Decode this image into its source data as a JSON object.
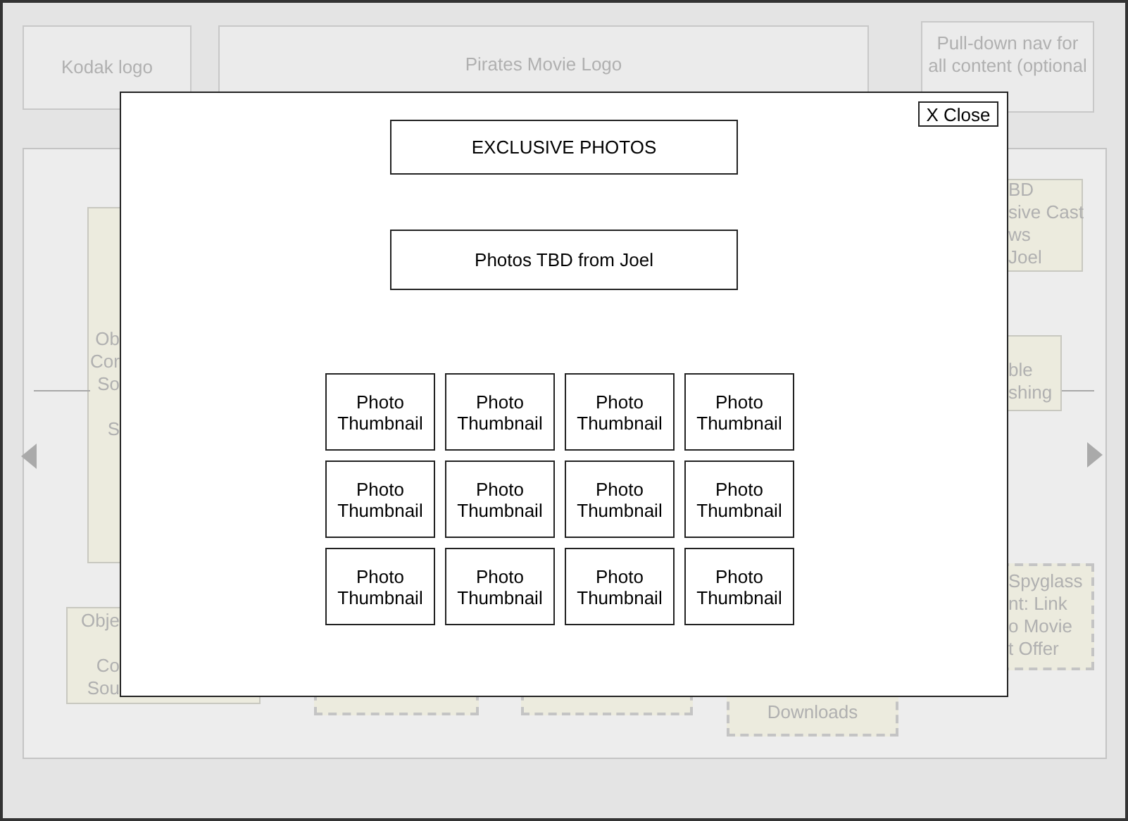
{
  "background": {
    "boxes": [
      {
        "kind": "solid",
        "paragraphs": [
          [
            "Kodak logo"
          ]
        ]
      },
      {
        "kind": "solid",
        "paragraphs": [
          [
            "Pirates Movie Logo"
          ]
        ]
      },
      {
        "kind": "solid",
        "paragraphs": [
          [
            "Pull-down nav for",
            "all content (optional"
          ]
        ]
      },
      {
        "kind": "note",
        "paragraphs": [
          [
            "Ob",
            "Cor",
            "So"
          ],
          [
            "S"
          ]
        ]
      },
      {
        "kind": "note",
        "paragraphs": [
          [
            "Obje"
          ],
          [
            "Co",
            "Sou"
          ]
        ]
      },
      {
        "kind": "dashed"
      },
      {
        "kind": "dashed"
      },
      {
        "kind": "dashed",
        "paragraphs": [
          [
            "Downloads"
          ]
        ]
      },
      {
        "kind": "note",
        "paragraphs": [
          [
            "BD",
            "sive Cast",
            "ws",
            "Joel"
          ]
        ]
      },
      {
        "kind": "note",
        "paragraphs": [
          [
            "ble",
            "shing"
          ]
        ]
      },
      {
        "kind": "dashed",
        "paragraphs": [
          [
            "Spyglass",
            "nt: Link",
            "o Movie",
            "t Offer"
          ]
        ]
      }
    ]
  },
  "modal": {
    "close": "X Close",
    "title": "EXCLUSIVE PHOTOS",
    "note": "Photos TBD from Joel",
    "thumbnails": [
      "Photo Thumbnail",
      "Photo Thumbnail",
      "Photo Thumbnail",
      "Photo Thumbnail",
      "Photo Thumbnail",
      "Photo Thumbnail",
      "Photo Thumbnail",
      "Photo Thumbnail",
      "Photo Thumbnail",
      "Photo Thumbnail",
      "Photo Thumbnail",
      "Photo Thumbnail"
    ]
  }
}
